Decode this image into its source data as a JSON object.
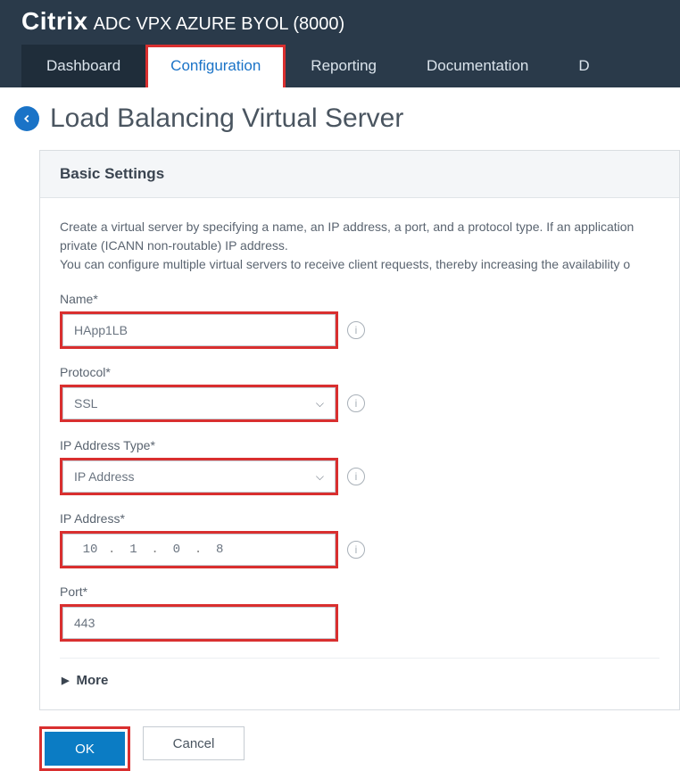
{
  "brand": {
    "name": "Citrix",
    "sub": "ADC VPX AZURE BYOL (8000)"
  },
  "tabs": {
    "dashboard": "Dashboard",
    "configuration": "Configuration",
    "reporting": "Reporting",
    "documentation": "Documentation",
    "d": "D"
  },
  "page": {
    "title": "Load Balancing Virtual Server"
  },
  "panel": {
    "header": "Basic Settings",
    "desc1": "Create a virtual server by specifying a name, an IP address, a port, and a protocol type. If an application",
    "desc2": "private (ICANN non-routable) IP address.",
    "desc3": "You can configure multiple virtual servers to receive client requests, thereby increasing the availability o",
    "fields": {
      "name": {
        "label": "Name*",
        "value": "HApp1LB"
      },
      "protocol": {
        "label": "Protocol*",
        "value": "SSL"
      },
      "ip_type": {
        "label": "IP Address Type*",
        "value": "IP Address"
      },
      "ip": {
        "label": "IP Address*",
        "o1": "10",
        "o2": "1",
        "o3": "0",
        "o4": "8"
      },
      "port": {
        "label": "Port*",
        "value": "443"
      }
    },
    "more": "More"
  },
  "buttons": {
    "ok": "OK",
    "cancel": "Cancel"
  }
}
